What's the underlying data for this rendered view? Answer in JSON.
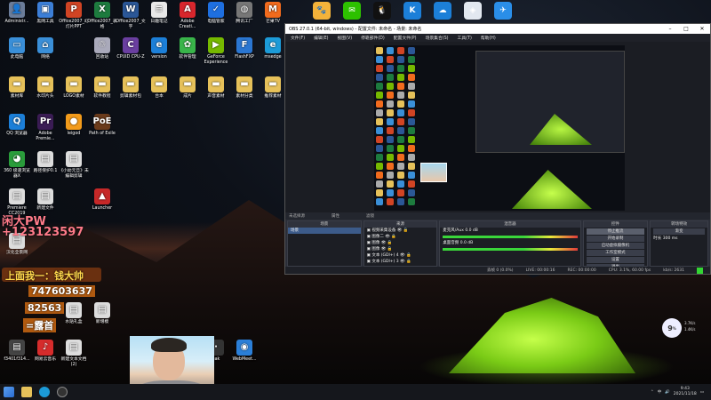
{
  "desktop": {
    "icons": [
      {
        "label": "Administr...",
        "color": "#6b7d9a",
        "sym": "👤"
      },
      {
        "label": "黑网工具",
        "color": "#3c7fd8",
        "sym": "▣"
      },
      {
        "label": "Office2007_幻灯片PPT",
        "color": "#d14424",
        "sym": "P"
      },
      {
        "label": "Office2007_表格",
        "color": "#1d7b3e",
        "sym": "X"
      },
      {
        "label": "Office2007_文字",
        "color": "#2b5797",
        "sym": "W"
      },
      {
        "label": "日趣笔记",
        "color": "#e9e9e9",
        "sym": "≡"
      },
      {
        "label": "Adobe Creati...",
        "color": "#d8262d",
        "sym": "A"
      },
      {
        "label": "电脑管家",
        "color": "#1e6fe0",
        "sym": "✓"
      },
      {
        "label": "腾讯工厂",
        "color": "#777",
        "sym": "◍"
      },
      {
        "label": "芒果TV",
        "color": "#f26b1d",
        "sym": "M"
      },
      {
        "label": "此电脑",
        "color": "#3a8fd8",
        "sym": "▭"
      },
      {
        "label": "网络",
        "color": "#3a8fd8",
        "sym": "⌂"
      },
      {
        "label": "回收站",
        "color": "#aab",
        "sym": "♲"
      },
      {
        "label": "CPUID CPU-Z",
        "color": "#6a3fa0",
        "sym": "C"
      },
      {
        "label": "version",
        "color": "#1c7fd8",
        "sym": "e"
      },
      {
        "label": "软件管理",
        "color": "#39b54a",
        "sym": "✿"
      },
      {
        "label": "GeForce Experience",
        "color": "#76b900",
        "sym": "▶"
      },
      {
        "label": "FlashFXP",
        "color": "#2a76d2",
        "sym": "F"
      },
      {
        "label": "msedge",
        "color": "#1c9bd8",
        "sym": "e"
      },
      {
        "label": "素材库",
        "color": "#e6c15a",
        "sym": "▬"
      },
      {
        "label": "水印片头",
        "color": "#e6c15a",
        "sym": "▬"
      },
      {
        "label": "LOGO素材",
        "color": "#e6c15a",
        "sym": "▬"
      },
      {
        "label": "软件教程",
        "color": "#e6c15a",
        "sym": "▬"
      },
      {
        "label": "剪辑素材包",
        "color": "#e6c15a",
        "sym": "▬"
      },
      {
        "label": "台本",
        "color": "#e6c15a",
        "sym": "▬"
      },
      {
        "label": "成片",
        "color": "#e6c15a",
        "sym": "▬"
      },
      {
        "label": "声音素材",
        "color": "#e6c15a",
        "sym": "▬"
      },
      {
        "label": "素材分类",
        "color": "#e6c15a",
        "sym": "▬"
      },
      {
        "label": "推荐素材",
        "color": "#e6c15a",
        "sym": "▬"
      },
      {
        "label": "QQ 浏览器",
        "color": "#1c7fd8",
        "sym": "Q"
      },
      {
        "label": "Adobe Premie...",
        "color": "#3b1c55",
        "sym": "Pr"
      },
      {
        "label": "leigod",
        "color": "#f39b1b",
        "sym": "●"
      },
      {
        "label": "Path of Exile",
        "color": "#6b3b1b",
        "sym": "PoE"
      },
      {
        "label": "360 极速浏览器X",
        "color": "#2a9d3b",
        "sym": "◕"
      },
      {
        "label": "路径保护0.1",
        "color": "#ddd",
        "sym": "▤"
      },
      {
        "label": "《小幼元旦》未编辑剪辑",
        "color": "#ddd",
        "sym": "▤"
      },
      {
        "label": "Premiere CC2019",
        "color": "#ddd",
        "sym": "▤"
      },
      {
        "label": "新建文件",
        "color": "#ddd",
        "sym": "▤"
      },
      {
        "label": "Launcher",
        "color": "#c62828",
        "sym": "▲"
      },
      {
        "label": "汉化全景网",
        "color": "#ddd",
        "sym": "▤"
      },
      {
        "label": "水贴礼盒",
        "color": "#ddd",
        "sym": "▤"
      },
      {
        "label": "新增模",
        "color": "#ddd",
        "sym": "▤"
      },
      {
        "label": "f3401f314...",
        "color": "#444",
        "sym": "▤"
      },
      {
        "label": "网易云音乐",
        "color": "#d62c2c",
        "sym": "♪"
      },
      {
        "label": "新建文本文档 (2)",
        "color": "#ddd",
        "sym": "▤"
      },
      {
        "label": "eak",
        "color": "#333",
        "sym": "·"
      },
      {
        "label": "WebMeet...",
        "color": "#2b7fd8",
        "sym": "◉"
      }
    ]
  },
  "overlay": {
    "line1": "闲大PW",
    "line2": "+123123597",
    "banner": "上面我一：钱大帅",
    "qq": "747603637",
    "v1": "82563",
    "v2": "=露首"
  },
  "top_apps": [
    {
      "name": "qq-pet",
      "color": "#f3b23a",
      "sym": "🐾"
    },
    {
      "name": "wechat",
      "color": "#2dc100",
      "sym": "✉"
    },
    {
      "name": "qq",
      "color": "#111",
      "sym": "🐧"
    },
    {
      "name": "k-app",
      "color": "#1c7fd8",
      "sym": "K"
    },
    {
      "name": "cloud",
      "color": "#1c7fd8",
      "sym": "☁"
    },
    {
      "name": "photos",
      "color": "#e2e8f0",
      "sym": "◈"
    },
    {
      "name": "bird",
      "color": "#2a8ee8",
      "sym": "✈"
    }
  ],
  "obs": {
    "title": "OBS 27.0.1 (64-bit, windows) - 配置文件: 未命名 - 场景: 未命名",
    "menu": [
      "文件(F)",
      "编辑(E)",
      "视图(V)",
      "停靠部件(D)",
      "配置文件(P)",
      "场景集合(S)",
      "工具(T)",
      "帮助(H)"
    ],
    "strip_label": "未选择源",
    "strip_props": "属性",
    "strip_filters": "滤镜",
    "docks": {
      "scenes_title": "场景",
      "scenes": [
        "场景"
      ],
      "sources_title": "来源",
      "sources": [
        "视频采集设备",
        "图像二",
        "图像",
        "图像",
        "文本 (GDI+) 4",
        "文本 (GDI+) 3"
      ],
      "mixer_title": "混音器",
      "mixer": [
        {
          "name": "麦克风/Aux",
          "db": "0.0 dB"
        },
        {
          "name": "桌面音频",
          "db": "0.0 dB"
        }
      ],
      "transitions_title": "转场特效",
      "transition_name": "渐变",
      "duration_label": "时长",
      "duration": "300 ms",
      "controls_title": "控件",
      "controls": [
        "停止推流",
        "开始录制",
        "启动虚拟摄像机",
        "工作室模式",
        "设置",
        "退出"
      ]
    },
    "status": {
      "dropped": "丢帧 0 (0.0%)",
      "live": "LIVE: 00:00:16",
      "rec": "REC: 00:00:00",
      "cpu": "CPU: 3.1%, 60.00 fps",
      "kbps": "kb/s: 2631"
    }
  },
  "taskbar": {
    "time": "9:43",
    "date": "2021/11/18",
    "lang": "中"
  },
  "assistant": {
    "value": "9",
    "unit": "%",
    "up": "3.7K/s",
    "down": "1.4K/s"
  }
}
